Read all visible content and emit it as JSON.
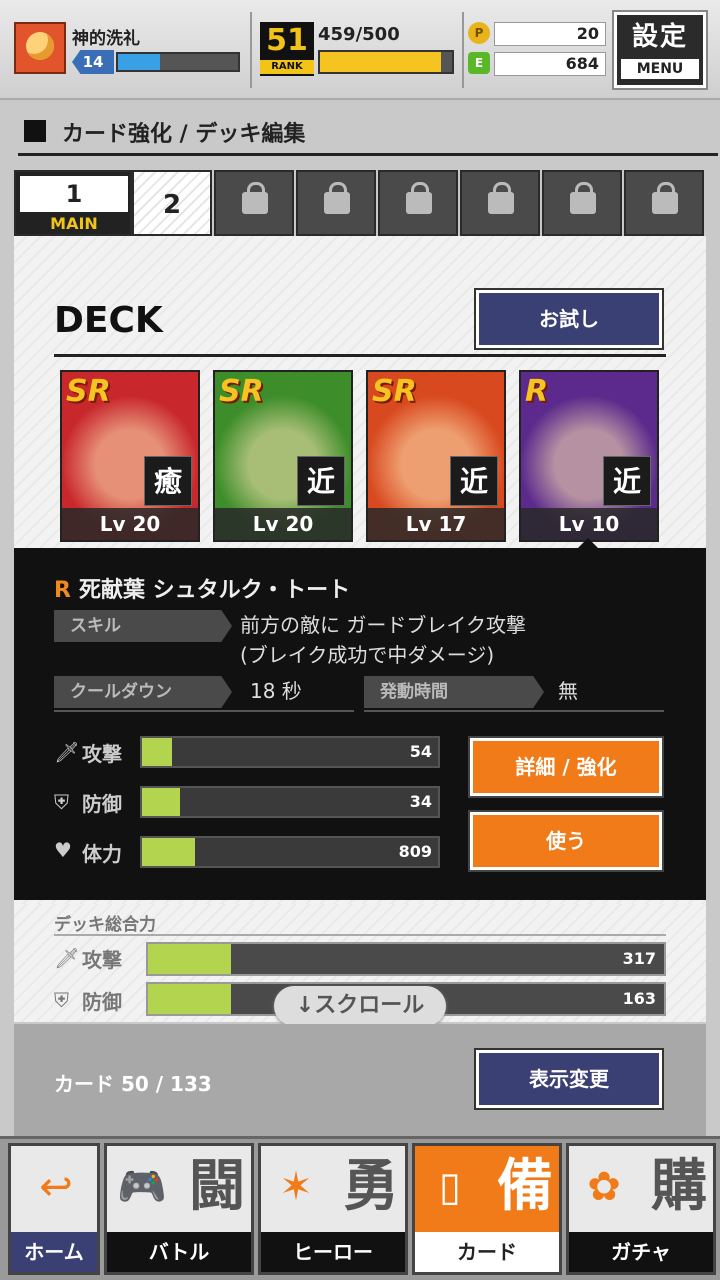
{
  "header": {
    "player_name": "神的洗礼",
    "player_level": "14",
    "xp_fraction": 0.35,
    "rank_number": "51",
    "rank_label": "RANK",
    "stamina_text": "459/500",
    "stamina_fraction": 0.918,
    "coin_icon": "P",
    "coin_count": "20",
    "energy_icon": "E",
    "energy_count": "684",
    "settings_label": "設定",
    "menu_label": "MENU"
  },
  "title": "カード強化 / デッキ編集",
  "deck_tabs": {
    "tab1_number": "1",
    "tab1_sub": "MAIN",
    "tab2_number": "2",
    "locked_count": 6
  },
  "deck": {
    "title": "DECK",
    "trial_button": "お試し",
    "cards": [
      {
        "rarity": "SR",
        "type": "癒",
        "level": "Lv 20",
        "bg": "#c8272c"
      },
      {
        "rarity": "SR",
        "type": "近",
        "level": "Lv 20",
        "bg": "#3d8d2a"
      },
      {
        "rarity": "SR",
        "type": "近",
        "level": "Lv 17",
        "bg": "#d9491f"
      },
      {
        "rarity": "R",
        "type": "近",
        "level": "Lv 10",
        "bg": "#5b2a8c"
      }
    ]
  },
  "detail": {
    "rarity": "R",
    "name": "死献葉 シュタルク・トート",
    "skill_label": "スキル",
    "skill_text_1": "前方の敵に ガードブレイク攻撃",
    "skill_text_2": "(ブレイク成功で中ダメージ)",
    "cooldown_label": "クールダウン",
    "cooldown_value": "18 秒",
    "activation_label": "発動時間",
    "activation_value": "無",
    "stats": [
      {
        "icon": "sword-icon",
        "label": "攻撃",
        "value": "54",
        "fraction": 0.1
      },
      {
        "icon": "shield-icon",
        "label": "防御",
        "value": "34",
        "fraction": 0.13
      },
      {
        "icon": "heart-icon",
        "label": "体力",
        "value": "809",
        "fraction": 0.18
      }
    ],
    "detail_button": "詳細 / 強化",
    "use_button": "使う"
  },
  "deck_total": {
    "title": "デッキ総合力",
    "stats": [
      {
        "label": "攻撃",
        "value": "317",
        "fraction": 0.16
      },
      {
        "label": "防御",
        "value": "163",
        "fraction": 0.16
      }
    ],
    "scroll_hint": "↓スクロール"
  },
  "card_count": "カード 50 / 133",
  "display_button": "表示変更",
  "nav": [
    {
      "label": "ホーム",
      "big": "",
      "icon": "home-icon"
    },
    {
      "label": "バトル",
      "big": "闘",
      "icon": "gamepad-icon"
    },
    {
      "label": "ヒーロー",
      "big": "勇",
      "icon": "hero-icon"
    },
    {
      "label": "カード",
      "big": "備",
      "icon": "card-icon"
    },
    {
      "label": "ガチャ",
      "big": "購",
      "icon": "gacha-icon"
    }
  ]
}
